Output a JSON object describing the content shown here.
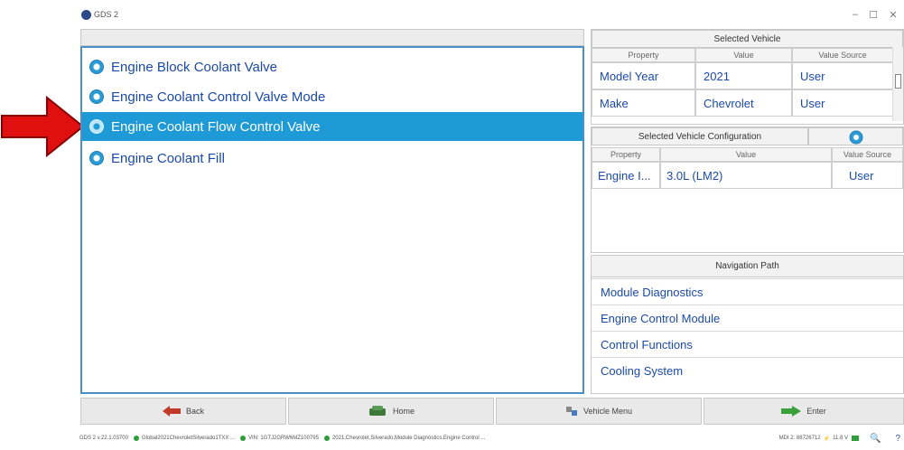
{
  "window": {
    "title": "GDS 2",
    "controls": [
      "–",
      "☐",
      "✕"
    ]
  },
  "list": {
    "items": [
      {
        "label": "Engine Block Coolant Valve",
        "selected": false
      },
      {
        "label": "Engine Coolant Control Valve Mode",
        "selected": false
      },
      {
        "label": "Engine Coolant Flow Control Valve",
        "selected": true
      },
      {
        "label": "Engine Coolant Fill",
        "selected": false
      }
    ]
  },
  "selected_vehicle": {
    "title": "Selected Vehicle",
    "headers": [
      "Property",
      "Value",
      "Value Source"
    ],
    "rows": [
      {
        "property": "Model Year",
        "value": "2021",
        "source": "User"
      },
      {
        "property": "Make",
        "value": "Chevrolet",
        "source": "User"
      }
    ]
  },
  "config": {
    "title": "Selected Vehicle Configuration",
    "headers": [
      "Property",
      "Value",
      "Value Source"
    ],
    "rows": [
      {
        "property": "Engine I...",
        "value": "3.0L (LM2)",
        "source": "User"
      }
    ]
  },
  "navigation": {
    "title": "Navigation Path",
    "items": [
      "Module Diagnostics",
      "Engine Control Module",
      "Control Functions",
      "Cooling System"
    ]
  },
  "bottom_buttons": {
    "back": "Back",
    "home": "Home",
    "vehicle_menu": "Vehicle Menu",
    "enter": "Enter"
  },
  "status": {
    "version": "GDS 2 v.22.1.03700",
    "vehicle": "Global2021ChevroletSilverado1TXX ...",
    "vin": "VIN: 1GTJ2GRW6MZ100795",
    "path": "2021,Chevrolet,Silverado,Module Diagnostics,Engine Control ...",
    "mdi": "MDI 2: 88726712",
    "voltage": "11.8 V"
  },
  "colors": {
    "selection": "#1e9ad6",
    "link_text": "#1b4aa8",
    "arrow": "#e01010"
  }
}
